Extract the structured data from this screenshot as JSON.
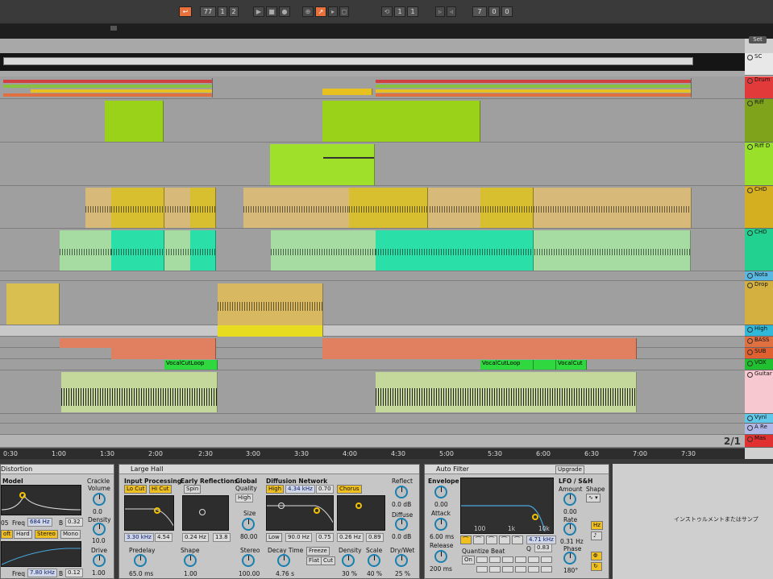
{
  "transport": {
    "tempo_left": "77",
    "bar_a": "1",
    "bar_b": "2",
    "pos_a": "1",
    "pos_b": "1",
    "loop_a": "7",
    "loop_b": "0",
    "loop_c": "0"
  },
  "set_button": "Set",
  "tracks": [
    {
      "name": "SC",
      "color": "#e8e8e8"
    },
    {
      "name": "Drum",
      "color": "#e23a3a"
    },
    {
      "name": "Riff",
      "color": "#7fa31a"
    },
    {
      "name": "Riff D",
      "color": "#98e02a"
    },
    {
      "name": "CHD",
      "color": "#d4b020"
    },
    {
      "name": "CHD",
      "color": "#22d090"
    },
    {
      "name": "Nota",
      "color": "#58b8e0"
    },
    {
      "name": "Drop",
      "color": "#d4b040"
    },
    {
      "name": "High",
      "color": "#30b8d8"
    },
    {
      "name": "BASS",
      "color": "#e07040"
    },
    {
      "name": "SUB",
      "color": "#e06030"
    },
    {
      "name": "VOX",
      "color": "#20c030"
    },
    {
      "name": "Guitar",
      "color": "#f8c8d0"
    },
    {
      "name": "Vynl",
      "color": "#60c8e8"
    },
    {
      "name": "A Re",
      "color": "#b0b8e8"
    },
    {
      "name": "Mas",
      "color": "#e03030"
    }
  ],
  "clip_labels": {
    "vocal_cut_loop": "VocalCutLoop",
    "vocal_cut": "VocalCut"
  },
  "ruler": [
    "0:30",
    "1:00",
    "1:30",
    "2:00",
    "2:30",
    "3:00",
    "3:30",
    "4:00",
    "4:30",
    "5:00",
    "5:30",
    "6:00",
    "6:30",
    "7:00",
    "7:30"
  ],
  "page_indicator": "2/1",
  "distortion": {
    "title": "Distortion",
    "model": "Model",
    "crackle": "Crackle",
    "volume": "Volume",
    "volume_val": "0.0",
    "density": "Density",
    "density_val": "10.0",
    "drive": "Drive",
    "drive_val": "1.00",
    "freq": "Freq",
    "freq_val": "684 Hz",
    "freq_left": "05",
    "b": "B",
    "b_val": "0.32",
    "soft": "oft",
    "hard": "Hard",
    "stereo": "Stereo",
    "mono": "Mono",
    "freq2": "Freq",
    "freq2_val": "7.80 kHz",
    "b2": "B",
    "b2_val": "0.12"
  },
  "reverb": {
    "title": "Large Hall",
    "input_processing": "Input Processing",
    "lo_cut": "Lo Cut",
    "hi_cut": "Hi Cut",
    "in_freq": "3.30 kHz",
    "in_q": "4.54",
    "early_reflections": "Early Reflections",
    "spin": "Spin",
    "er_rate": "0.24 Hz",
    "er_amt": "13.8",
    "global": "Global",
    "quality": "Quality",
    "quality_val": "High",
    "size": "Size",
    "size_val": "80.00",
    "diffusion_network": "Diffusion Network",
    "high": "High",
    "high_freq": "4.34 kHz",
    "high_val": "0.70",
    "chorus": "Chorus",
    "low": "Low",
    "low_freq": "90.0 Hz",
    "low_val": "0.75",
    "chorus_rate": "0.26 Hz",
    "chorus_amt": "0.89",
    "reflect": "Reflect",
    "reflect_val": "0.0 dB",
    "diffuse": "Diffuse",
    "diffuse_val": "0.0 dB",
    "predelay": "Predelay",
    "predelay_val": "65.0 ms",
    "shape": "Shape",
    "shape_val": "1.00",
    "stereo": "Stereo",
    "stereo_val": "100.00",
    "decay_time": "Decay Time",
    "decay_val": "4.76 s",
    "freeze": "Freeze",
    "flat": "Flat",
    "cut": "Cut",
    "density": "Density",
    "density_val": "30 %",
    "scale": "Scale",
    "scale_val": "40 %",
    "drywet": "Dry/Wet",
    "drywet_val": "25 %"
  },
  "autofilter": {
    "title": "Auto Filter",
    "upgrade": "Upgrade",
    "envelope": "Envelope",
    "env_val": "0.00",
    "attack": "Attack",
    "attack_val": "6.00 ms",
    "release": "Release",
    "release_val": "200 ms",
    "t100": "100",
    "t1k": "1k",
    "t10k": "10k",
    "freq_val": "4.71 kHz",
    "q": "Q",
    "q_val": "0.83",
    "quantize_beat": "Quantize Beat",
    "on": "On",
    "lfo": "LFO / S&H",
    "amount": "Amount",
    "amount_val": "0.00",
    "shape": "Shape",
    "rate": "Rate",
    "rate_val": "0.31 Hz",
    "hz": "Hz",
    "phase": "Phase",
    "phase_val": "180°"
  },
  "instrument_hint": "インストゥルメントまたはサンプ"
}
